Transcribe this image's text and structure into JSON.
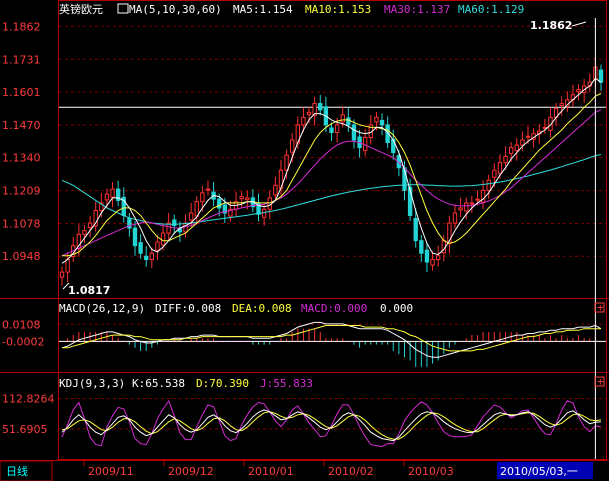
{
  "colors": {
    "background": "#000000",
    "frame": "#b40000",
    "grid": "#7a0000",
    "up": "#ff3030",
    "down": "#24d3d3",
    "label": "#ff3c3c",
    "white": "#ffffff",
    "ma5": "#ffffff",
    "ma10": "#ffff3c",
    "ma30": "#d42cd4",
    "ma60": "#32dcdc",
    "status_bg": "#0000b4",
    "tab_text": "#00ffff"
  },
  "price_panel": {
    "symbol": "英镑欧元",
    "indicator": "MA(5,10,30,60)",
    "ma5_label": "MA5:1.154",
    "ma10_label": "MA10:1.153",
    "ma30_label": "MA30:1.137",
    "ma60_label": "MA60:1.129",
    "high_label": "1.1862",
    "low_label": "1.0817"
  },
  "macd_panel": {
    "indicator": "MACD(26,12,9)",
    "diff_label": "DIFF:0.008",
    "dea_label": "DEA:0.008",
    "macd_label": "MACD:0.000",
    "extra_value": "0.000"
  },
  "kdj_panel": {
    "indicator": "KDJ(9,3,3)",
    "k_label": "K:65.538",
    "d_label": "D:70.390",
    "j_label": "J:55.833"
  },
  "period_tab": "日线",
  "cursor_date": "2010/05/03,一",
  "chart_data": [
    {
      "type": "candlestick",
      "series": [
        {
          "name": "MA5",
          "color": "#ffffff"
        },
        {
          "name": "MA10",
          "color": "#ffff3c"
        },
        {
          "name": "MA30",
          "color": "#d42cd4"
        },
        {
          "name": "MA60",
          "color": "#32dcdc"
        }
      ],
      "y_ticks": [
        "1.1862",
        "1.1731",
        "1.1601",
        "1.1470",
        "1.1340",
        "1.1209",
        "1.1078",
        "1.0948"
      ],
      "ylim": [
        1.079,
        1.1895
      ],
      "x_ticks": [
        "2009/11",
        "2009/12",
        "2010/01",
        "2010/02",
        "2010/03"
      ],
      "reference_line": 1.154,
      "closes": [
        1.0885,
        1.0935,
        1.099,
        1.1035,
        1.105,
        1.108,
        1.113,
        1.116,
        1.1195,
        1.1215,
        1.117,
        1.111,
        1.106,
        1.099,
        1.096,
        1.0935,
        1.096,
        1.1005,
        1.104,
        1.108,
        1.107,
        1.1045,
        1.108,
        1.112,
        1.1165,
        1.12,
        1.1215,
        1.1175,
        1.114,
        1.112,
        1.1135,
        1.1165,
        1.1185,
        1.118,
        1.1145,
        1.1115,
        1.1135,
        1.118,
        1.123,
        1.129,
        1.135,
        1.141,
        1.147,
        1.15,
        1.152,
        1.1555,
        1.153,
        1.147,
        1.144,
        1.147,
        1.151,
        1.147,
        1.141,
        1.138,
        1.142,
        1.147,
        1.15,
        1.147,
        1.14,
        1.136,
        1.13,
        1.121,
        1.111,
        1.101,
        1.096,
        1.0925,
        1.0935,
        1.095,
        1.101,
        1.108,
        1.112,
        1.114,
        1.116,
        1.116,
        1.1175,
        1.121,
        1.125,
        1.129,
        1.132,
        1.1345,
        1.138,
        1.139,
        1.141,
        1.1425,
        1.1435,
        1.1445,
        1.146,
        1.15,
        1.1535,
        1.1555,
        1.157,
        1.159,
        1.161,
        1.1625,
        1.164,
        1.17,
        1.164
      ],
      "ma5": [
        1.092,
        1.0935,
        1.096,
        1.099,
        1.102,
        1.105,
        1.108,
        1.112,
        1.115,
        1.118,
        1.118,
        1.117,
        1.114,
        1.11,
        1.106,
        1.101,
        1.0975,
        1.0965,
        1.0985,
        1.101,
        1.104,
        1.106,
        1.107,
        1.108,
        1.1105,
        1.114,
        1.117,
        1.119,
        1.1185,
        1.1165,
        1.115,
        1.115,
        1.1155,
        1.1165,
        1.1165,
        1.115,
        1.1145,
        1.115,
        1.117,
        1.122,
        1.128,
        1.134,
        1.14,
        1.145,
        1.149,
        1.1515,
        1.1515,
        1.1505,
        1.149,
        1.148,
        1.1475,
        1.1465,
        1.145,
        1.144,
        1.1435,
        1.144,
        1.146,
        1.146,
        1.144,
        1.141,
        1.136,
        1.129,
        1.121,
        1.113,
        1.106,
        1.1,
        1.096,
        1.0955,
        1.0975,
        1.101,
        1.105,
        1.1085,
        1.1115,
        1.114,
        1.116,
        1.1175,
        1.12,
        1.1235,
        1.127,
        1.13,
        1.1335,
        1.136,
        1.1385,
        1.1405,
        1.142,
        1.1435,
        1.145,
        1.147,
        1.15,
        1.1525,
        1.155,
        1.157,
        1.159,
        1.161,
        1.1625,
        1.1655,
        1.164
      ],
      "ma10": [
        1.095,
        1.095,
        1.0955,
        1.0965,
        1.0985,
        1.1005,
        1.103,
        1.106,
        1.109,
        1.111,
        1.113,
        1.114,
        1.114,
        1.113,
        1.111,
        1.108,
        1.105,
        1.1025,
        1.101,
        1.101,
        1.102,
        1.103,
        1.104,
        1.106,
        1.108,
        1.11,
        1.112,
        1.114,
        1.115,
        1.116,
        1.116,
        1.116,
        1.116,
        1.1165,
        1.1165,
        1.116,
        1.116,
        1.116,
        1.117,
        1.1185,
        1.121,
        1.125,
        1.129,
        1.133,
        1.137,
        1.141,
        1.144,
        1.146,
        1.1475,
        1.1485,
        1.149,
        1.149,
        1.148,
        1.147,
        1.1465,
        1.146,
        1.146,
        1.1455,
        1.145,
        1.143,
        1.14,
        1.136,
        1.131,
        1.125,
        1.119,
        1.113,
        1.108,
        1.104,
        1.101,
        1.1,
        1.1005,
        1.102,
        1.104,
        1.1065,
        1.109,
        1.1115,
        1.114,
        1.1165,
        1.119,
        1.1215,
        1.1245,
        1.127,
        1.1295,
        1.132,
        1.1345,
        1.137,
        1.139,
        1.141,
        1.143,
        1.145,
        1.1475,
        1.1495,
        1.1515,
        1.154,
        1.156,
        1.1585,
        1.1595
      ],
      "ma30": [
        1.095,
        1.096,
        1.097,
        1.098,
        1.099,
        1.1,
        1.101,
        1.102,
        1.103,
        1.104,
        1.105,
        1.106,
        1.107,
        1.1075,
        1.108,
        1.1085,
        1.108,
        1.1075,
        1.107,
        1.1065,
        1.106,
        1.106,
        1.1065,
        1.107,
        1.108,
        1.109,
        1.11,
        1.111,
        1.112,
        1.1125,
        1.113,
        1.1135,
        1.114,
        1.1145,
        1.115,
        1.115,
        1.1155,
        1.116,
        1.117,
        1.118,
        1.1195,
        1.1215,
        1.1235,
        1.126,
        1.1285,
        1.131,
        1.1335,
        1.1355,
        1.1375,
        1.139,
        1.14,
        1.1405,
        1.1405,
        1.14,
        1.139,
        1.138,
        1.137,
        1.136,
        1.135,
        1.134,
        1.132,
        1.13,
        1.1275,
        1.125,
        1.123,
        1.121,
        1.119,
        1.1175,
        1.1165,
        1.1155,
        1.115,
        1.1148,
        1.1148,
        1.115,
        1.1155,
        1.116,
        1.1168,
        1.1178,
        1.119,
        1.1205,
        1.122,
        1.124,
        1.126,
        1.128,
        1.13,
        1.132,
        1.134,
        1.136,
        1.138,
        1.14,
        1.142,
        1.144,
        1.146,
        1.148,
        1.15,
        1.152,
        1.153
      ],
      "ma60": [
        1.125,
        1.124,
        1.123,
        1.1215,
        1.12,
        1.1185,
        1.117,
        1.1155,
        1.114,
        1.113,
        1.112,
        1.111,
        1.11,
        1.1095,
        1.109,
        1.1085,
        1.108,
        1.1078,
        1.1076,
        1.1075,
        1.1075,
        1.1076,
        1.1078,
        1.108,
        1.1083,
        1.1086,
        1.109,
        1.1093,
        1.1096,
        1.1099,
        1.1102,
        1.1105,
        1.1108,
        1.1111,
        1.1115,
        1.1118,
        1.1122,
        1.1126,
        1.113,
        1.1135,
        1.114,
        1.1146,
        1.1152,
        1.1158,
        1.1164,
        1.117,
        1.1176,
        1.1182,
        1.1188,
        1.1193,
        1.1198,
        1.1203,
        1.1207,
        1.1211,
        1.1215,
        1.1218,
        1.1221,
        1.1224,
        1.1226,
        1.1228,
        1.123,
        1.1231,
        1.1232,
        1.1232,
        1.1232,
        1.1231,
        1.123,
        1.1229,
        1.1228,
        1.1227,
        1.1227,
        1.1227,
        1.1228,
        1.1229,
        1.1231,
        1.1233,
        1.1236,
        1.1239,
        1.1243,
        1.1247,
        1.1252,
        1.1257,
        1.1262,
        1.1267,
        1.1273,
        1.1279,
        1.1285,
        1.1291,
        1.1297,
        1.1304,
        1.1311,
        1.1318,
        1.1325,
        1.1332,
        1.134,
        1.1348,
        1.1352
      ]
    },
    {
      "type": "bar+line",
      "y_ticks": [
        "0.0108",
        "-0.0002"
      ],
      "ylim": [
        -0.018,
        0.016
      ],
      "series": [
        {
          "name": "DIFF",
          "color": "#ffffff"
        },
        {
          "name": "DEA",
          "color": "#ffff3c"
        },
        {
          "name": "MACD",
          "color": "#d42cd4"
        }
      ],
      "diff": [
        -0.004,
        -0.003,
        -0.001,
        0.001,
        0.002,
        0.003,
        0.004,
        0.005,
        0.006,
        0.006,
        0.005,
        0.004,
        0.003,
        0.001,
        0.0,
        -0.001,
        -0.001,
        0.0,
        0.001,
        0.001,
        0.002,
        0.002,
        0.002,
        0.003,
        0.003,
        0.004,
        0.004,
        0.004,
        0.003,
        0.003,
        0.003,
        0.003,
        0.003,
        0.003,
        0.002,
        0.002,
        0.002,
        0.002,
        0.003,
        0.004,
        0.005,
        0.007,
        0.009,
        0.01,
        0.011,
        0.012,
        0.012,
        0.011,
        0.011,
        0.011,
        0.011,
        0.01,
        0.009,
        0.008,
        0.008,
        0.008,
        0.008,
        0.008,
        0.007,
        0.005,
        0.003,
        0.001,
        -0.002,
        -0.005,
        -0.007,
        -0.009,
        -0.01,
        -0.01,
        -0.009,
        -0.008,
        -0.007,
        -0.006,
        -0.005,
        -0.004,
        -0.003,
        -0.002,
        -0.001,
        0.0,
        0.001,
        0.002,
        0.003,
        0.004,
        0.004,
        0.005,
        0.005,
        0.006,
        0.006,
        0.007,
        0.007,
        0.008,
        0.008,
        0.008,
        0.009,
        0.009,
        0.009,
        0.01,
        0.008
      ],
      "dea": [
        -0.004,
        -0.004,
        -0.003,
        -0.002,
        -0.001,
        0.0,
        0.001,
        0.002,
        0.003,
        0.004,
        0.004,
        0.004,
        0.004,
        0.003,
        0.003,
        0.002,
        0.001,
        0.001,
        0.001,
        0.001,
        0.001,
        0.001,
        0.002,
        0.002,
        0.002,
        0.003,
        0.003,
        0.003,
        0.003,
        0.003,
        0.003,
        0.003,
        0.003,
        0.003,
        0.003,
        0.003,
        0.003,
        0.003,
        0.003,
        0.003,
        0.004,
        0.004,
        0.005,
        0.006,
        0.007,
        0.008,
        0.009,
        0.01,
        0.01,
        0.01,
        0.01,
        0.01,
        0.01,
        0.01,
        0.009,
        0.009,
        0.009,
        0.009,
        0.008,
        0.008,
        0.007,
        0.006,
        0.004,
        0.003,
        0.001,
        -0.001,
        -0.003,
        -0.004,
        -0.005,
        -0.006,
        -0.006,
        -0.006,
        -0.006,
        -0.006,
        -0.005,
        -0.005,
        -0.004,
        -0.003,
        -0.002,
        -0.001,
        0.0,
        0.001,
        0.002,
        0.003,
        0.003,
        0.004,
        0.005,
        0.005,
        0.006,
        0.006,
        0.007,
        0.007,
        0.007,
        0.008,
        0.008,
        0.008,
        0.008
      ]
    },
    {
      "type": "line",
      "y_ticks": [
        "112.8264",
        "51.6905"
      ],
      "ylim": [
        -5,
        130
      ],
      "series": [
        {
          "name": "K",
          "color": "#ffffff"
        },
        {
          "name": "D",
          "color": "#ffff3c"
        },
        {
          "name": "J",
          "color": "#d42cd4"
        }
      ],
      "k": [
        45,
        55,
        70,
        80,
        70,
        55,
        45,
        40,
        50,
        62,
        75,
        78,
        70,
        55,
        45,
        38,
        42,
        55,
        68,
        80,
        74,
        60,
        50,
        45,
        50,
        62,
        75,
        80,
        72,
        58,
        48,
        44,
        52,
        63,
        76,
        85,
        90,
        86,
        78,
        70,
        72,
        80,
        86,
        82,
        74,
        65,
        55,
        50,
        55,
        66,
        78,
        84,
        80,
        70,
        58,
        45,
        38,
        32,
        30,
        28,
        35,
        48,
        60,
        72,
        82,
        86,
        84,
        76,
        66,
        58,
        52,
        48,
        45,
        44,
        50,
        60,
        70,
        80,
        84,
        82,
        78,
        80,
        84,
        86,
        80,
        70,
        60,
        55,
        60,
        72,
        84,
        88,
        80,
        70,
        62,
        65,
        66
      ],
      "d": [
        50,
        52,
        60,
        68,
        70,
        66,
        58,
        50,
        48,
        55,
        65,
        72,
        72,
        66,
        56,
        47,
        42,
        46,
        56,
        66,
        72,
        68,
        60,
        52,
        48,
        53,
        63,
        72,
        74,
        68,
        58,
        50,
        48,
        55,
        66,
        76,
        84,
        86,
        83,
        77,
        73,
        75,
        80,
        82,
        79,
        72,
        64,
        56,
        53,
        58,
        67,
        76,
        80,
        77,
        69,
        58,
        48,
        40,
        34,
        31,
        31,
        38,
        48,
        60,
        70,
        79,
        84,
        82,
        76,
        68,
        60,
        54,
        49,
        46,
        46,
        52,
        61,
        70,
        78,
        81,
        80,
        80,
        82,
        84,
        83,
        77,
        69,
        62,
        59,
        63,
        72,
        80,
        82,
        77,
        70,
        68,
        70
      ],
      "j": [
        35,
        60,
        90,
        105,
        72,
        35,
        20,
        18,
        55,
        78,
        95,
        92,
        66,
        32,
        22,
        20,
        42,
        72,
        92,
        108,
        78,
        44,
        30,
        30,
        56,
        80,
        100,
        96,
        68,
        38,
        28,
        32,
        60,
        80,
        96,
        105,
        102,
        86,
        68,
        56,
        70,
        90,
        98,
        82,
        64,
        50,
        36,
        38,
        58,
        82,
        100,
        100,
        80,
        56,
        36,
        20,
        18,
        16,
        22,
        22,
        42,
        68,
        84,
        96,
        106,
        100,
        84,
        64,
        46,
        38,
        36,
        36,
        37,
        40,
        58,
        76,
        88,
        100,
        96,
        84,
        74,
        80,
        88,
        90,
        74,
        56,
        42,
        40,
        62,
        90,
        108,
        104,
        76,
        56,
        46,
        58,
        56
      ]
    }
  ]
}
